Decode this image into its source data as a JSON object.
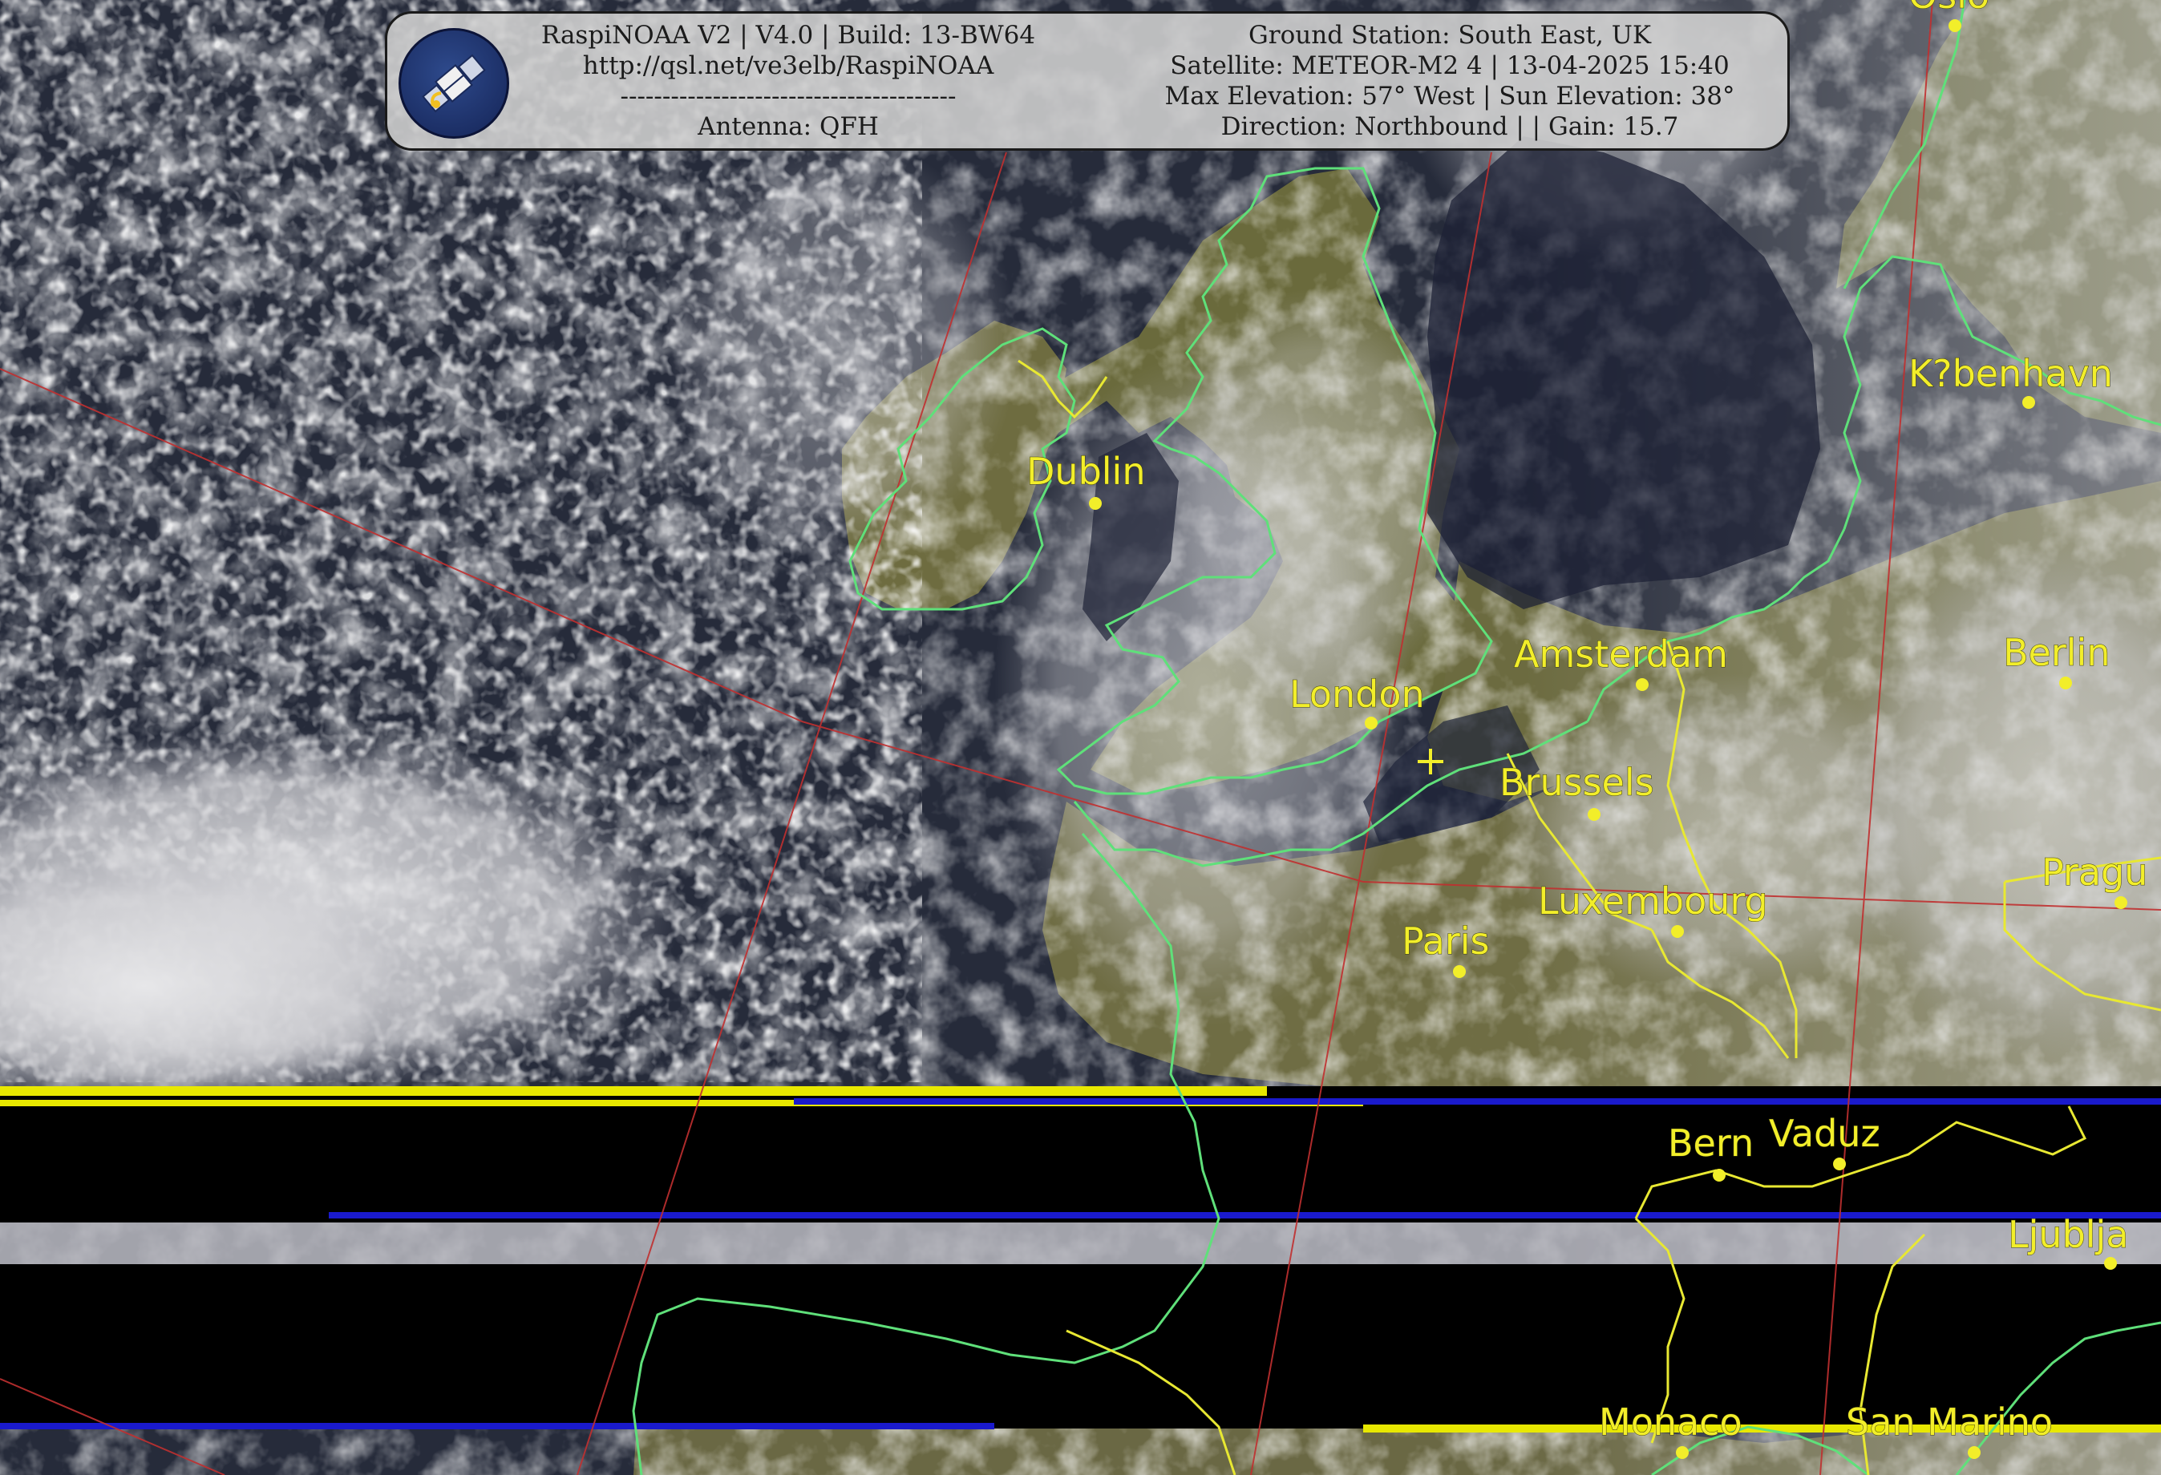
{
  "header": {
    "left_lines": [
      "RaspiNOAA V2 | V4.0 | Build: 13-BW64",
      "http://qsl.net/ve3elb/RaspiNOAA",
      "----------------------------------------",
      "Antenna: QFH"
    ],
    "right_lines": [
      "Ground Station: South East, UK",
      "Satellite: METEOR-M2 4 | 13-04-2025 15:40",
      "Max Elevation: 57° West | Sun Elevation: 38°",
      "Direction: Northbound | | Gain: 15.7"
    ],
    "logo_icon": "satellite-icon"
  },
  "cities": [
    {
      "name": "Oslo",
      "label": "Oslo"
    },
    {
      "name": "Kobenhavn",
      "label": "K?benhavn"
    },
    {
      "name": "Dublin",
      "label": "Dublin"
    },
    {
      "name": "Amsterdam",
      "label": "Amsterdam"
    },
    {
      "name": "Berlin",
      "label": "Berlin"
    },
    {
      "name": "London",
      "label": "London"
    },
    {
      "name": "Brussels",
      "label": "Brussels"
    },
    {
      "name": "Prague",
      "label": "Pragu"
    },
    {
      "name": "Luxembourg",
      "label": "Luxembourg"
    },
    {
      "name": "Paris",
      "label": "Paris"
    },
    {
      "name": "Bern",
      "label": "Bern"
    },
    {
      "name": "Vaduz",
      "label": "Vaduz"
    },
    {
      "name": "Ljubljana",
      "label": "Ljublja"
    },
    {
      "name": "Monaco",
      "label": "Monaco"
    },
    {
      "name": "San Marino",
      "label": "San Marino"
    }
  ],
  "colors": {
    "coastline": "#5fe07a",
    "border": "#e8e832",
    "graticule": "#c03030",
    "city_label": "#f2ee2a",
    "noise_band": "#000000",
    "scan_blue": "#1a1acc",
    "scan_yellow": "#e8e800"
  }
}
